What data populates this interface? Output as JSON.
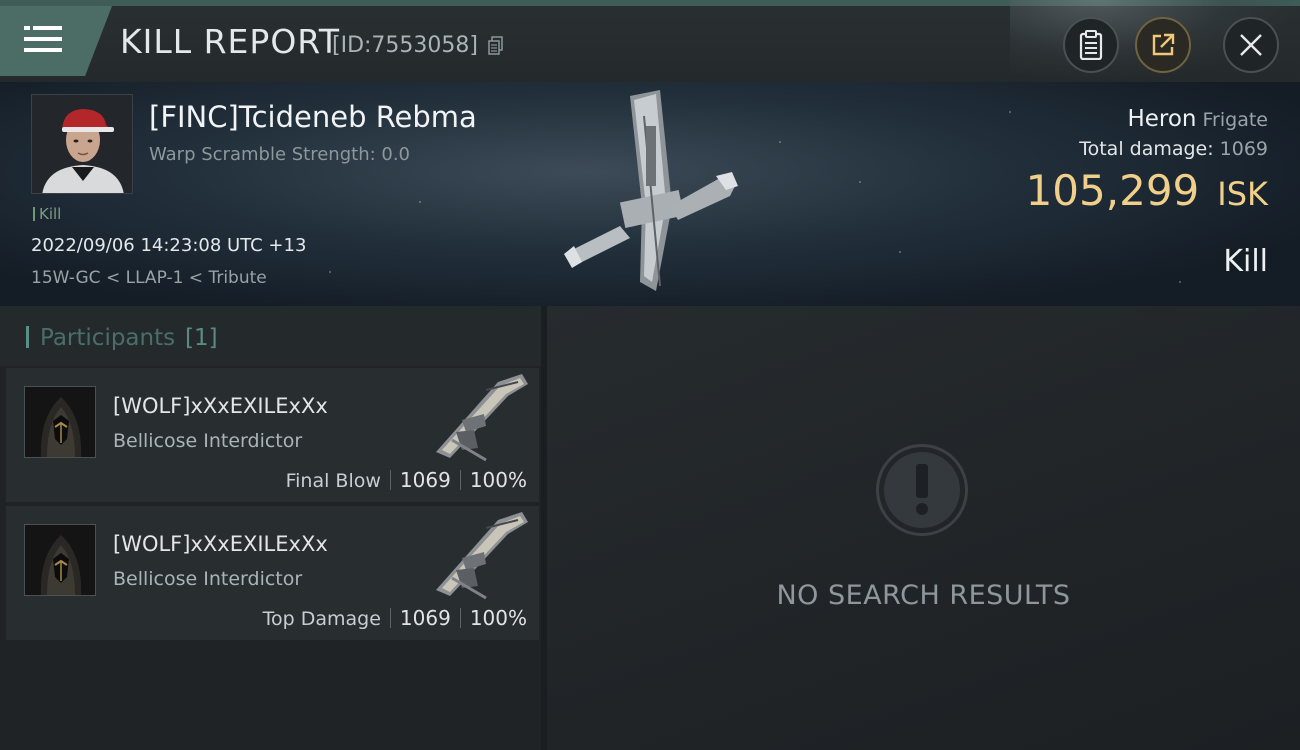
{
  "header": {
    "title": "KILL REPORT",
    "report_id": "[ID:7553058]"
  },
  "toolbar": {
    "menu_icon": "hamburger-menu-icon",
    "copy_icon": "copy-icon",
    "clipboard_icon": "clipboard-icon",
    "share_icon": "share-icon",
    "close_icon": "close-icon"
  },
  "victim": {
    "name": "[FINC]Tcideneb Rebma",
    "warp_scramble": "Warp Scramble Strength: 0.0",
    "tag": "Kill",
    "datetime": "2022/09/06 14:23:08 UTC +13",
    "location": "15W-GC < LLAP-1 < Tribute",
    "ship_name": "Heron",
    "ship_class": "Frigate",
    "total_damage_label": "Total damage:",
    "total_damage": "1069",
    "isk_value": "105,299",
    "isk_unit": "ISK",
    "result": "Kill"
  },
  "participants": {
    "title": "Participants",
    "count": "[1]",
    "rows": [
      {
        "name": "[WOLF]xXxEXILExXx",
        "ship": "Bellicose Interdictor",
        "tag": "Final Blow",
        "damage": "1069",
        "percent": "100%"
      },
      {
        "name": "[WOLF]xXxEXILExXx",
        "ship": "Bellicose Interdictor",
        "tag": "Top Damage",
        "damage": "1069",
        "percent": "100%"
      }
    ]
  },
  "results_panel": {
    "empty_icon": "exclamation-icon",
    "empty_text": "NO SEARCH RESULTS"
  },
  "colors": {
    "accent": "#4c6c66",
    "isk_gold": "#f0cf8a",
    "background": "#1b1e21"
  }
}
